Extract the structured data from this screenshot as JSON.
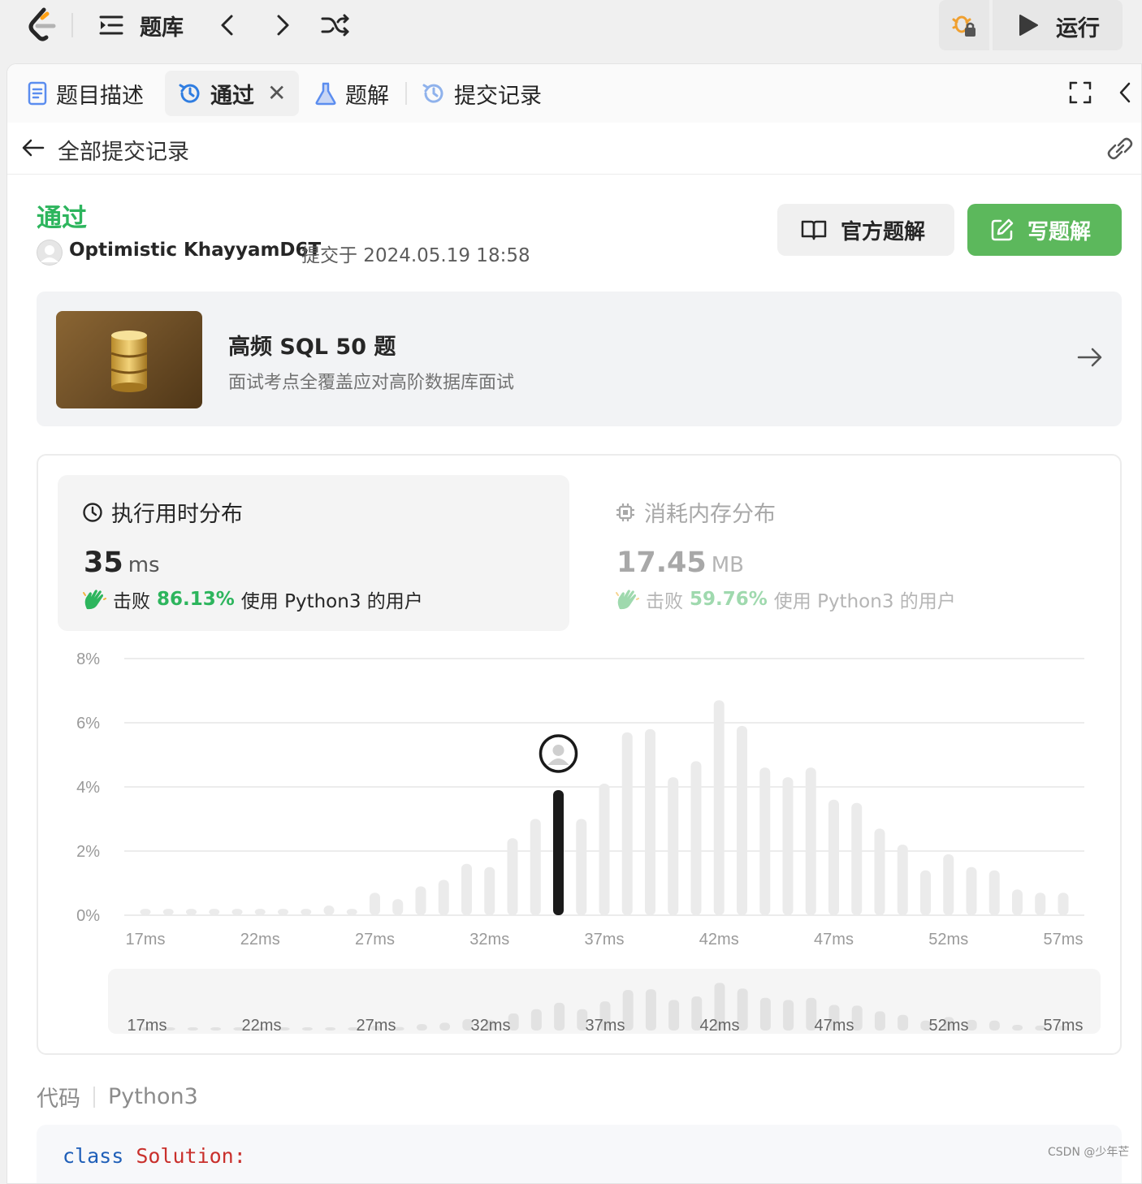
{
  "topbar": {
    "title": "题库",
    "run_label": "运行"
  },
  "tabs": [
    {
      "label": "题目描述",
      "icon": "document-icon"
    },
    {
      "label": "通过",
      "icon": "history-icon",
      "active": true,
      "closable": true
    },
    {
      "label": "题解",
      "icon": "flask-icon"
    },
    {
      "label": "提交记录",
      "icon": "history-icon"
    }
  ],
  "back_row": {
    "label": "全部提交记录"
  },
  "submission": {
    "status": "通过",
    "user": "Optimistic KhayyamD6T",
    "submitted_at": "提交于 2024.05.19 18:58"
  },
  "buttons": {
    "official": "官方题解",
    "write": "写题解"
  },
  "promo": {
    "title": "高频 SQL 50 题",
    "subtitle": "面试考点全覆盖应对高阶数据库面试"
  },
  "runtime": {
    "heading": "执行用时分布",
    "value": "35",
    "unit": "ms",
    "beat_prefix": "击败",
    "beat_pct": "86.13%",
    "beat_suffix": "使用 Python3 的用户"
  },
  "memory": {
    "heading": "消耗内存分布",
    "value": "17.45",
    "unit": "MB",
    "beat_prefix": "击败",
    "beat_pct": "59.76%",
    "beat_suffix": "使用 Python3 的用户"
  },
  "chart_data": {
    "type": "bar",
    "x": [
      17,
      18,
      19,
      20,
      21,
      22,
      23,
      24,
      25,
      26,
      27,
      28,
      29,
      30,
      31,
      32,
      33,
      34,
      35,
      36,
      37,
      38,
      39,
      40,
      41,
      42,
      43,
      44,
      45,
      46,
      47,
      48,
      49,
      50,
      51,
      52,
      53,
      54,
      55,
      56,
      57
    ],
    "values": [
      0.2,
      0.2,
      0.2,
      0.2,
      0.2,
      0.2,
      0.2,
      0.2,
      0.3,
      0.2,
      0.7,
      0.5,
      0.9,
      1.1,
      1.6,
      1.5,
      2.4,
      3.0,
      3.9,
      3.0,
      4.1,
      5.7,
      5.8,
      4.3,
      4.8,
      6.7,
      5.9,
      4.6,
      4.3,
      4.6,
      3.6,
      3.5,
      2.7,
      2.2,
      1.4,
      1.9,
      1.5,
      1.4,
      0.8,
      0.7,
      0.7
    ],
    "highlight_x": 35,
    "ylim": [
      0,
      8
    ],
    "yticks": [
      "0%",
      "2%",
      "4%",
      "6%",
      "8%"
    ],
    "xticks": [
      "17ms",
      "22ms",
      "27ms",
      "32ms",
      "37ms",
      "42ms",
      "47ms",
      "52ms",
      "57ms"
    ],
    "grid": true,
    "colors": {
      "bar": "#ebebeb",
      "highlight": "#1a1a1a",
      "grid": "#e6e6e6"
    }
  },
  "code": {
    "heading": "代码",
    "language": "Python3",
    "line1_kw": "class",
    "line1_name": "Solution:"
  },
  "watermark": "CSDN @少年芒",
  "colors": {
    "accent_green": "#2db55d",
    "write_button": "#5cb85c"
  }
}
